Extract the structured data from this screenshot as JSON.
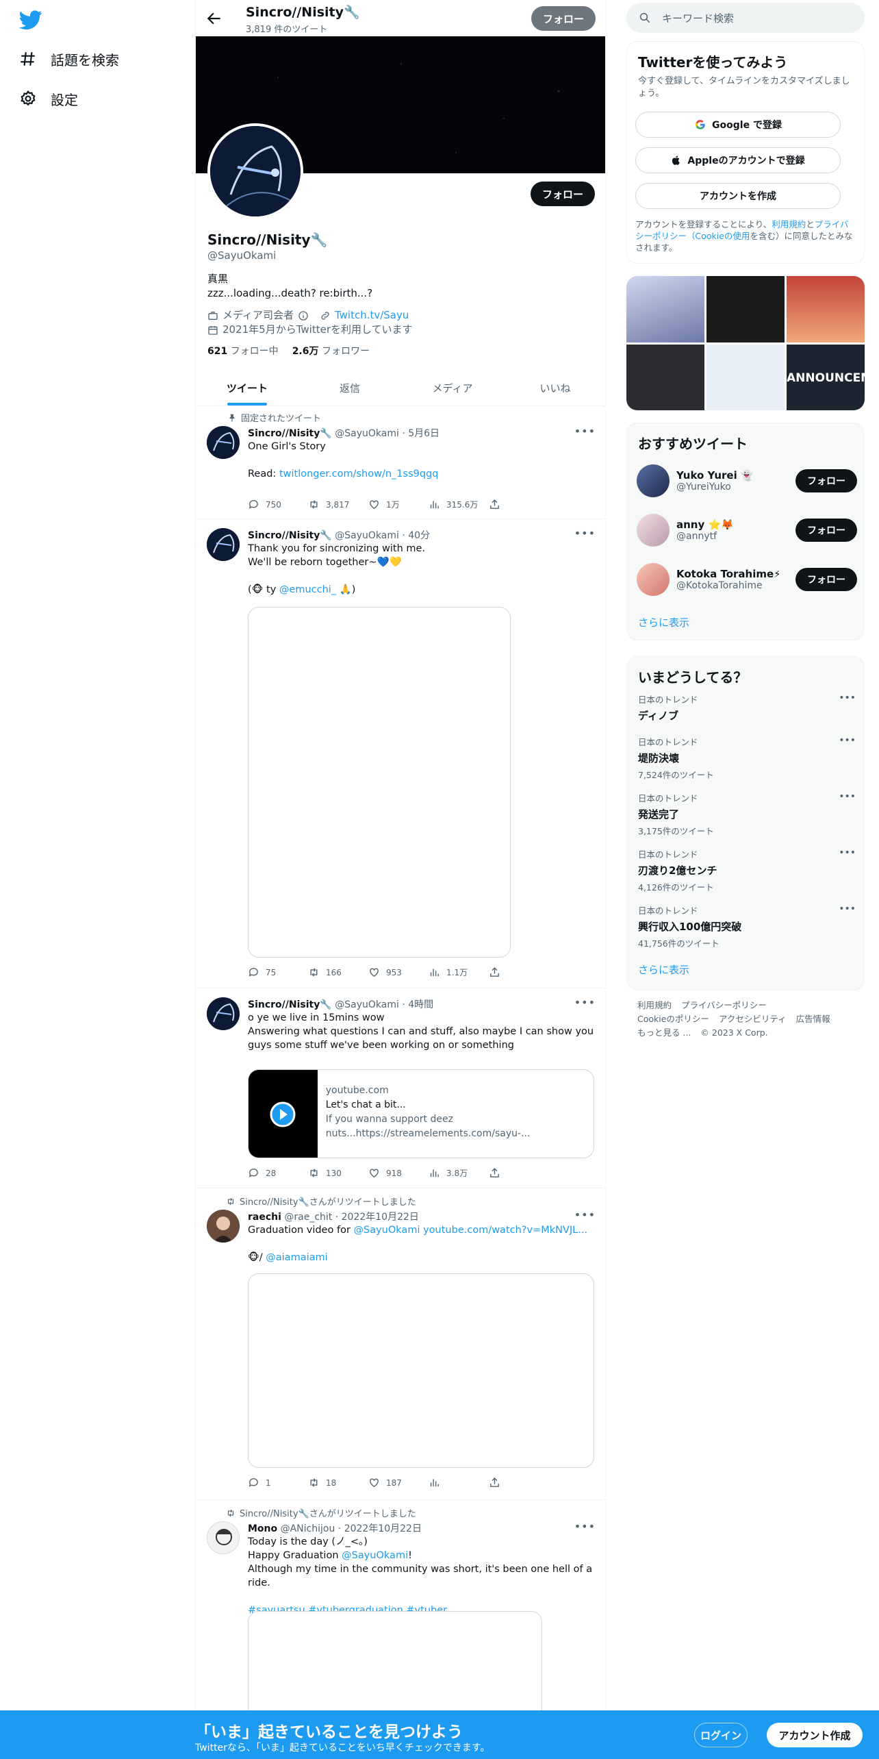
{
  "nav": {
    "explore": "話題を検索",
    "settings": "設定"
  },
  "header": {
    "name": "Sincro//Nisity🔧",
    "tweet_count": "3,819 件のツイート",
    "follow": "フォロー"
  },
  "profile": {
    "name": "Sincro//Nisity🔧",
    "handle": "@SayuOkami",
    "bio_line1": "真黒",
    "bio_line2": "zzz...loading...death? re:birth...?",
    "category": "メディア司会者",
    "link": "Twitch.tv/Sayu",
    "joined": "2021年5月からTwitterを利用しています",
    "following_count": "621",
    "following_label": "フォロー中",
    "followers_count": "2.6万",
    "followers_label": "フォロワー",
    "follow_button": "フォロー"
  },
  "tabs": [
    "ツイート",
    "返信",
    "メディア",
    "いいね"
  ],
  "tweets": [
    {
      "social": "固定されたツイート",
      "name": "Sincro//Nisity🔧",
      "handle": "@SayuOkami",
      "time": "5月6日",
      "line1": "One Girl's Story",
      "line2": "Read: ",
      "link": "twitlonger.com/show/n_1ss9qgq",
      "reply": "750",
      "retweet": "3,817",
      "like": "1万",
      "views": "315.6万"
    },
    {
      "name": "Sincro//Nisity🔧",
      "handle": "@SayuOkami",
      "time": "40分",
      "line1": "Thank you for sincronizing with me.",
      "line2": "We'll be reborn together~💙💛",
      "line3_pre": "(🐵 ty ",
      "mention": "@emucchi_",
      "line3_post": " 🙏)",
      "reply": "75",
      "retweet": "166",
      "like": "953",
      "views": "1.1万"
    },
    {
      "name": "Sincro//Nisity🔧",
      "handle": "@SayuOkami",
      "time": "4時間",
      "line1": "o ye we live in 15mins wow",
      "line2": "Answering what questions I can and stuff, also maybe I can show you guys some stuff we've been working on or something",
      "card_domain": "youtube.com",
      "card_title": "Let's chat a bit...",
      "card_desc": "If you wanna support deez nuts...https://streamelements.com/sayu-...",
      "reply": "28",
      "retweet": "130",
      "like": "918",
      "views": "3.8万"
    },
    {
      "social": "Sincro//Nisity🔧さんがリツイートしました",
      "name": "raechi",
      "handle": "@rae_chit",
      "time": "2022年10月22日",
      "line1_pre": "Graduation video for ",
      "mention": "@SayuOkami",
      "link": "youtube.com/watch?v=MkNVJL...",
      "line2_pre": "🐵/ ",
      "mention2": "@aiamaiami",
      "reply": "1",
      "retweet": "18",
      "like": "187",
      "views": ""
    },
    {
      "social": "Sincro//Nisity🔧さんがリツイートしました",
      "name": "Mono",
      "handle": "@ANichijou",
      "time": "2022年10月22日",
      "line1": "Today is the day (ノ_<。)",
      "line2_pre": "Happy Graduation ",
      "mention": "@SayuOkami",
      "line2_post": "!",
      "line3": "Although my time in the community was short, it's been one hell of a ride.",
      "hashtags": "#sayuartsu #vtubergraduation #vtuber"
    }
  ],
  "right": {
    "search_placeholder": "キーワード検索",
    "signup_title": "Twitterを使ってみよう",
    "signup_sub": "今すぐ登録して、タイムラインをカスタマイズしましょう。",
    "google": "Google で登録",
    "apple": "Appleのアカウントで登録",
    "create": "アカウントを作成",
    "terms_pre": "アカウントを登録することにより、",
    "terms_link1": "利用規約",
    "terms_mid": "と",
    "terms_link2": "プライバシーポリシー（Cookieの使用",
    "terms_post": "を含む）に同意したとみなされます。",
    "media_text": "ANNOUNCEME",
    "rec_title": "おすすめツイート",
    "recs": [
      {
        "name": "Yuko Yurei 👻",
        "handle": "@YureiYuko",
        "follow": "フォロー"
      },
      {
        "name": "anny ⭐🦊",
        "handle": "@annytf",
        "follow": "フォロー"
      },
      {
        "name": "Kotoka Torahime⚡…",
        "handle": "@KotokaTorahime",
        "follow": "フォロー"
      }
    ],
    "show_more": "さらに表示",
    "trends_title": "いまどうしてる？",
    "trends": [
      {
        "cat": "日本のトレンド",
        "name": "ディノブ",
        "count": ""
      },
      {
        "cat": "日本のトレンド",
        "name": "堤防決壊",
        "count": "7,524件のツイート"
      },
      {
        "cat": "日本のトレンド",
        "name": "発送完了",
        "count": "3,175件のツイート"
      },
      {
        "cat": "日本のトレンド",
        "name": "刃渡り2億センチ",
        "count": "4,126件のツイート"
      },
      {
        "cat": "日本のトレンド",
        "name": "興行収入100億円突破",
        "count": "41,756件のツイート"
      }
    ],
    "footer": [
      "利用規約",
      "プライバシーポリシー",
      "Cookieのポリシー",
      "アクセシビリティ",
      "広告情報",
      "もっと見る ...",
      "© 2023 X Corp."
    ]
  },
  "bottom": {
    "title": "「いま」起きていることを見つけよう",
    "sub": "Twitterなら、「いま」起きていることをいち早くチェックできます。",
    "login": "ログイン",
    "signup": "アカウント作成"
  },
  "colors": {
    "accent": "#1d9bf0",
    "text": "#0f1419",
    "secondary": "#536471"
  }
}
